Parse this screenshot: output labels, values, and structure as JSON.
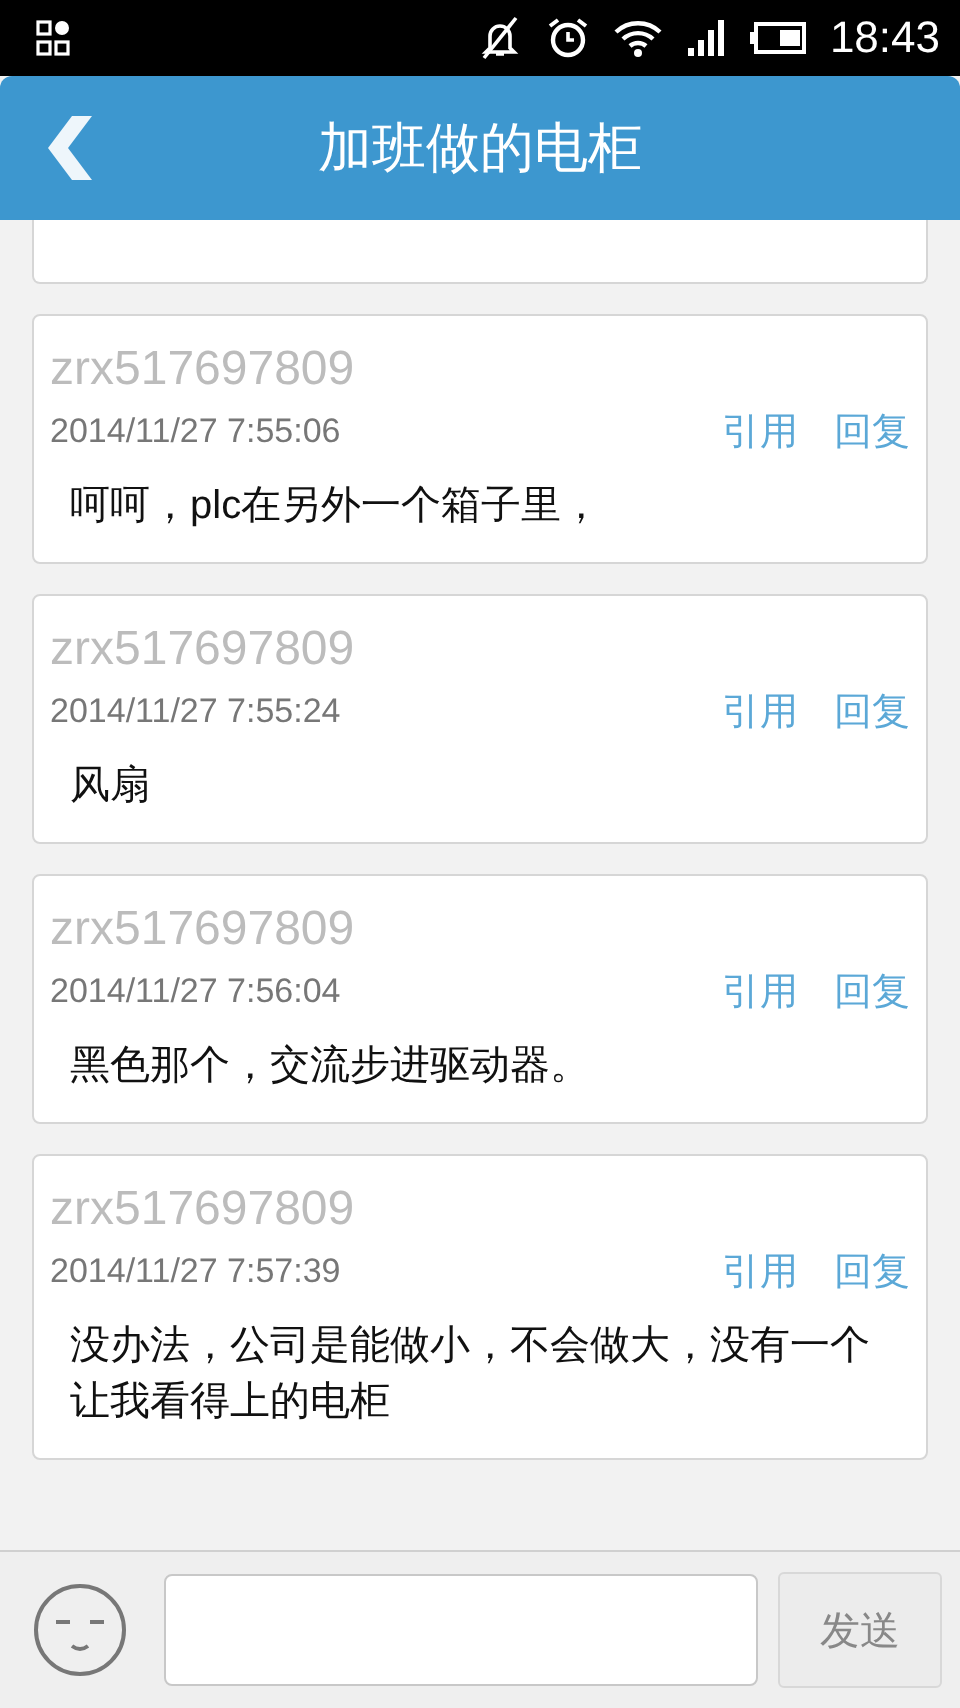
{
  "status_bar": {
    "time": "18:43"
  },
  "header": {
    "title": "加班做的电柜"
  },
  "posts": [
    {
      "author": "zrx517697809",
      "time": "2014/11/27 7:55:06",
      "actions": [
        "引用",
        "回复"
      ],
      "body": "呵呵，plc在另外一个箱子里，"
    },
    {
      "author": "zrx517697809",
      "time": "2014/11/27 7:55:24",
      "actions": [
        "引用",
        "回复"
      ],
      "body": "风扇"
    },
    {
      "author": "zrx517697809",
      "time": "2014/11/27 7:56:04",
      "actions": [
        "引用",
        "回复"
      ],
      "body": "黑色那个，交流步进驱动器。"
    },
    {
      "author": "zrx517697809",
      "time": "2014/11/27 7:57:39",
      "actions": [
        "引用",
        "回复"
      ],
      "body": "没办法，公司是能做小，不会做大，没有一个让我看得上的电柜"
    }
  ],
  "composer": {
    "send": "发送"
  }
}
